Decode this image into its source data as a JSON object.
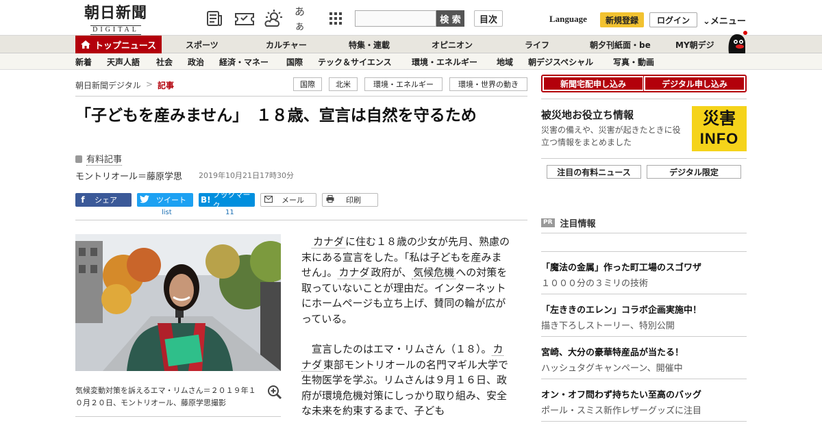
{
  "header": {
    "logo_jp": "朝日新聞",
    "logo_en": "DIGITAL",
    "aa_label": "あぁ",
    "search_button": "検 索",
    "toc_button": "目次",
    "language": "Language",
    "signup": "新規登録",
    "login": "ログイン",
    "menu": "メニュー"
  },
  "nav_main": {
    "top_news": "トップニュース",
    "items": [
      "スポーツ",
      "カルチャー",
      "特集・連載",
      "オピニオン",
      "ライフ",
      "朝夕刊紙面・be",
      "MY朝デジ"
    ]
  },
  "nav_sub": {
    "items": [
      "新着",
      "天声人語",
      "社会",
      "政治",
      "経済・マネー",
      "国際",
      "テック＆サイエンス",
      "環境・エネルギー",
      "地域",
      "朝デジスペシャル",
      "写真・動画"
    ]
  },
  "breadcrumb": {
    "home": "朝日新聞デジタル",
    "sep": ">",
    "current": "記事"
  },
  "tags": [
    "国際",
    "北米",
    "環境・エネルギー",
    "環境・世界の動き"
  ],
  "article": {
    "title": "「子どもを産みません」　１８歳、宣言は自然を守るため",
    "paid_label": "有料記事",
    "byline": "モントリオール＝藤原学思",
    "date": "2019年10月21日17時30分",
    "caption": "気候変動対策を訴えるエマ・リムさん＝２０１９年１０月２０日、モントリオール、藤原学思撮影",
    "p1": {
      "kw1": "カナダ",
      "t1": "に住む１８歳の少女が先月、熟慮の末にある宣言をした。「私は子どもを産みません」。",
      "kw2": "カナダ",
      "t2": "政府が、",
      "kw3": "気候危機",
      "t3": "への対策を取っていないことが理由だ。インターネットにホームページも立ち上げ、賛同の輪が広がっている。"
    },
    "p2": {
      "t1": "宣言したのはエマ・リムさん（１８）。",
      "kw1": "カナダ",
      "t2": "東部モントリオールの名門マギル大学で生物医学を学ぶ。リムさんは９月１６日、政府が環境危機対策にしっかり取り組み、安全な未来を約束するまで、子ども"
    }
  },
  "share": {
    "facebook": "シェア",
    "twitter": "ツイート",
    "twitter_count": "list",
    "hatena": "ブックマーク",
    "hatena_count": "11",
    "mail": "メール",
    "print": "印刷"
  },
  "sidebar": {
    "btn_home_delivery": "新聞宅配申し込み",
    "btn_digital": "デジタル申し込み",
    "disaster_title": "被災地お役立ち情報",
    "disaster_desc": "災害の備えや、災害が起きたときに役立つ情報をまとめました",
    "saigai_a": "災害",
    "saigai_b": "INFO",
    "tab_paid_news": "注目の有料ニュース",
    "tab_digital_only": "デジタル限定",
    "pr_badge": "PR",
    "pr_heading": "注目情報",
    "ads": [
      {
        "title": "「魔法の金属」作った町工場のスゴワザ",
        "sub": "１０００分の３ミリの技術"
      },
      {
        "title": "「左ききのエレン」コラボ企画実施中！",
        "sub": "描き下ろしストーリー、特別公開"
      },
      {
        "title": "宮崎、大分の豪華特産品が当たる！",
        "sub": "ハッシュタグキャンペーン、開催中"
      },
      {
        "title": "オン・オフ問わず持ちたい至高のバッグ",
        "sub": "ポール・スミス新作レザーグッズに注目"
      }
    ]
  },
  "colors": {
    "brand_red": "#b3000b",
    "signup_yellow": "#f2c230",
    "facebook": "#3b5998",
    "twitter": "#1da1f2",
    "hatena": "#008fde"
  }
}
